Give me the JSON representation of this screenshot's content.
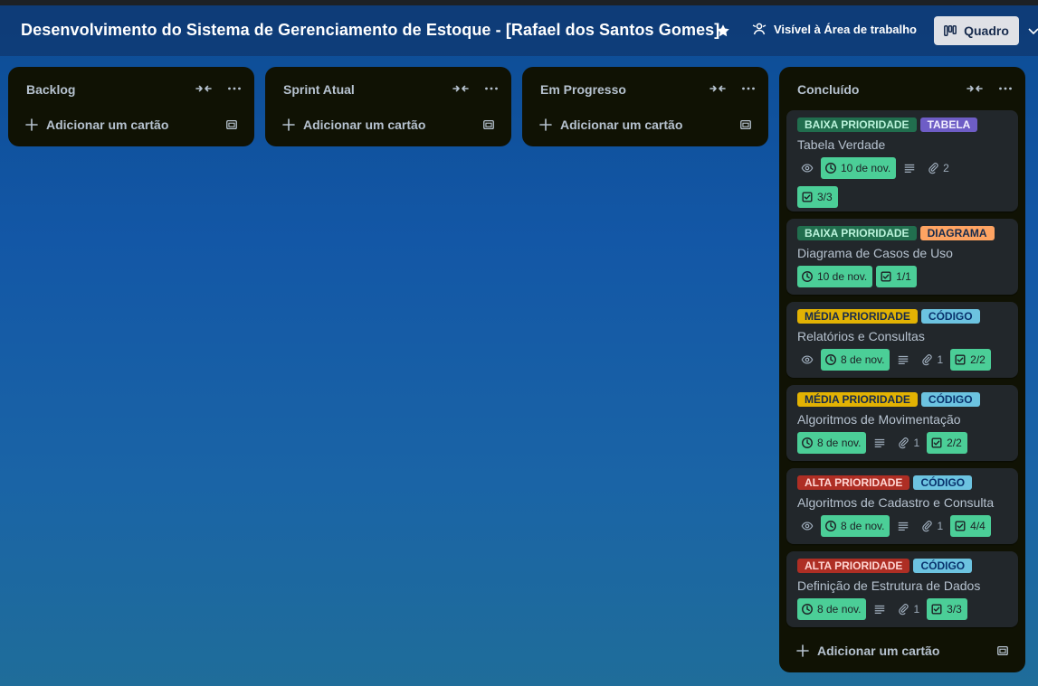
{
  "header": {
    "board_title": "Desenvolvimento do Sistema de Gerenciamento de Estoque - [Rafael dos Santos Gomes]",
    "visibility_label": "Visível à Área de trabalho",
    "view_label": "Quadro"
  },
  "lists": [
    {
      "title": "Backlog",
      "add_label": "Adicionar um cartão"
    },
    {
      "title": "Sprint Atual",
      "add_label": "Adicionar um cartão"
    },
    {
      "title": "Em Progresso",
      "add_label": "Adicionar um cartão"
    },
    {
      "title": "Concluído",
      "add_label": "Adicionar um cartão"
    }
  ],
  "cards": [
    {
      "labels": [
        "BAIXA PRIORIDADE",
        "TABELA"
      ],
      "title": "Tabela Verdade",
      "due": "10 de nov.",
      "attachments": "2",
      "checklist": "3/3"
    },
    {
      "labels": [
        "BAIXA PRIORIDADE",
        "DIAGRAMA"
      ],
      "title": "Diagrama de Casos de Uso",
      "due": "10 de nov.",
      "checklist": "1/1"
    },
    {
      "labels": [
        "MÉDIA PRIORIDADE",
        "CÓDIGO"
      ],
      "title": "Relatórios e Consultas",
      "due": "8 de nov.",
      "attachments": "1",
      "checklist": "2/2"
    },
    {
      "labels": [
        "MÉDIA PRIORIDADE",
        "CÓDIGO"
      ],
      "title": "Algoritmos de Movimentação",
      "due": "8 de nov.",
      "attachments": "1",
      "checklist": "2/2"
    },
    {
      "labels": [
        "ALTA PRIORIDADE",
        "CÓDIGO"
      ],
      "title": "Algoritmos de Cadastro e Consulta",
      "due": "8 de nov.",
      "attachments": "1",
      "checklist": "4/4"
    },
    {
      "labels": [
        "ALTA PRIORIDADE",
        "CÓDIGO"
      ],
      "title": "Definição de Estrutura de Dados",
      "due": "8 de nov.",
      "attachments": "1",
      "checklist": "3/3"
    }
  ],
  "colors": {
    "board_background": "#1357a6",
    "list_background": "#101204",
    "card_background": "#22272b",
    "date_badge_green": "#4bce97",
    "label_low": "#216e4e",
    "label_medium": "#e2b203",
    "label_high": "#ae2e24",
    "label_table": "#6e5dc6",
    "label_diagram": "#fea362",
    "label_code": "#6cc3e0"
  },
  "icons": [
    "star-icon",
    "visibility-icon",
    "board-view-icon",
    "chevron-down-icon",
    "collapse-icon",
    "more-icon",
    "plus-icon",
    "template-icon",
    "watch-icon",
    "clock-icon",
    "description-icon",
    "attachment-icon",
    "checklist-icon"
  ]
}
